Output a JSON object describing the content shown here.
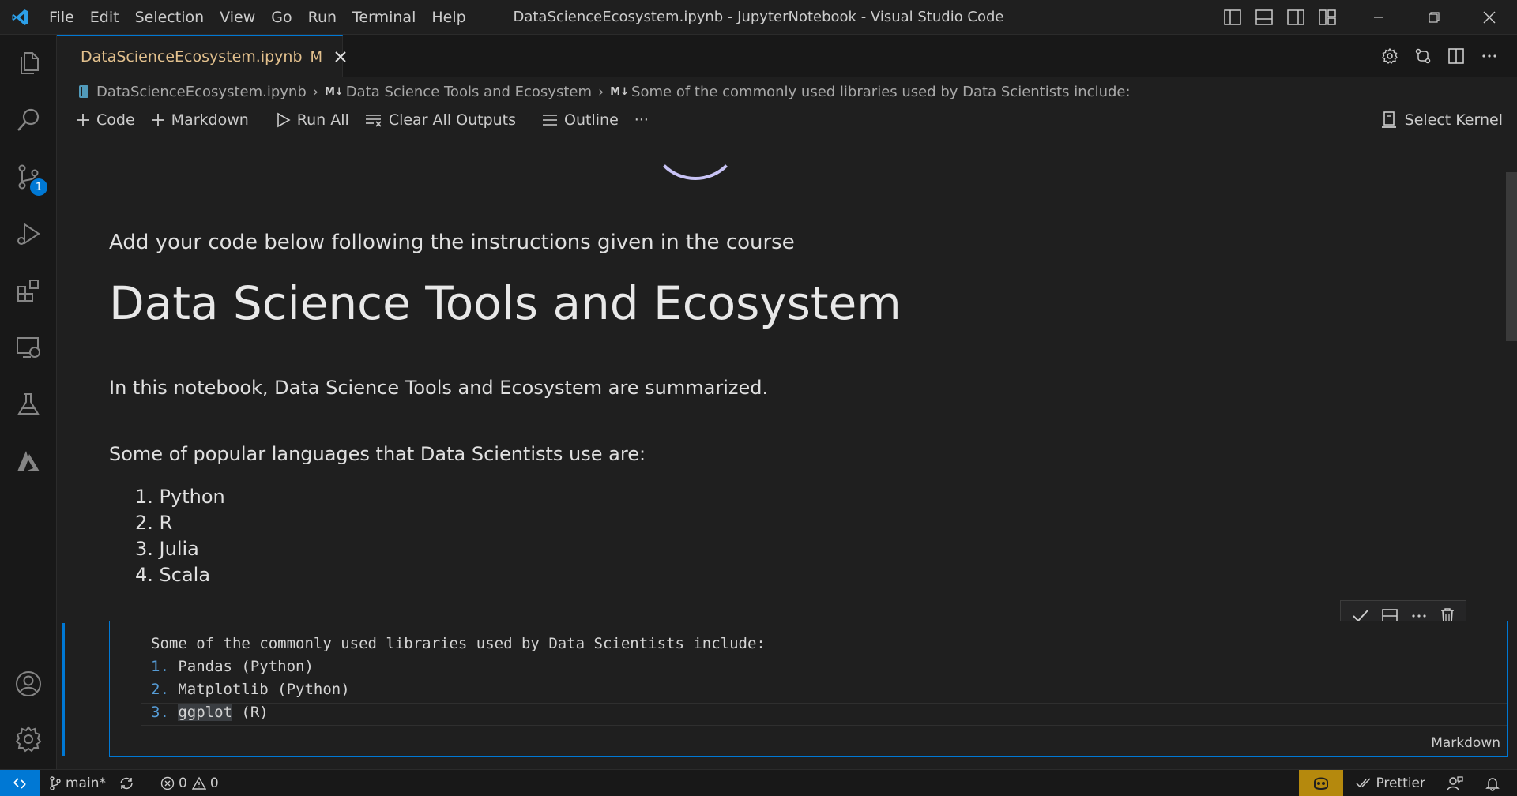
{
  "window": {
    "title": "DataScienceEcosystem.ipynb - JupyterNotebook - Visual Studio Code",
    "menu": [
      "File",
      "Edit",
      "Selection",
      "View",
      "Go",
      "Run",
      "Terminal",
      "Help"
    ]
  },
  "activity_bar": {
    "items": [
      "explorer-icon",
      "search-icon",
      "source-control-icon",
      "run-debug-icon",
      "extensions-icon",
      "remote-explorer-icon",
      "testing-icon",
      "azure-icon"
    ],
    "source_control_badge": "1",
    "bottom": [
      "accounts-icon",
      "settings-gear-icon"
    ]
  },
  "tab": {
    "label": "DataScienceEcosystem.ipynb",
    "status": "M"
  },
  "breadcrumb": {
    "file": "DataScienceEcosystem.ipynb",
    "md_marker": "M↓",
    "section": "Data Science Tools and Ecosystem",
    "cell": "Some of the commonly used libraries used by Data Scientists include:"
  },
  "toolbar": {
    "code": "Code",
    "markdown": "Markdown",
    "run_all": "Run All",
    "clear_outputs": "Clear All Outputs",
    "outline": "Outline",
    "more": "···",
    "kernel": "Select Kernel"
  },
  "notebook": {
    "intro": "Add your code below following the instructions given in the course",
    "heading": "Data Science Tools and Ecosystem",
    "summary": "In this notebook, Data Science Tools and Ecosystem are summarized.",
    "languages_intro": "Some of popular languages that Data Scientists use are:",
    "languages": [
      "1. Python",
      "2. R",
      "3. Julia",
      "4. Scala"
    ],
    "active_cell": {
      "line1": "Some of the commonly used libraries used by Data Scientists include:",
      "items": [
        {
          "num": "1.",
          "text": "Pandas (Python)"
        },
        {
          "num": "2.",
          "text": "Matplotlib (Python)"
        },
        {
          "num": "3.",
          "highlight": "ggplot",
          "rest": " (R)"
        }
      ],
      "language": "Markdown"
    }
  },
  "status_bar": {
    "branch": "main*",
    "errors": "0",
    "warnings": "0",
    "prettier": "Prettier"
  },
  "colors": {
    "accent": "#0078d4",
    "modified_tab": "#e2c08d",
    "copilot_bg": "#b5890d"
  }
}
